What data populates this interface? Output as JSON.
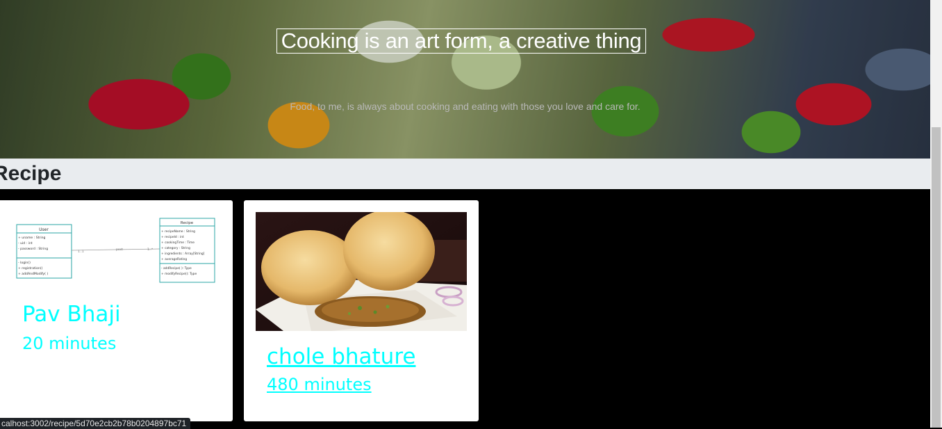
{
  "hero": {
    "title": "Cooking is an art form, a creative thing",
    "subtitle": "Food, to me, is always about cooking and eating with those you love and care for."
  },
  "section": {
    "title": "Recipe"
  },
  "recipes": [
    {
      "name": "Pav Bhaji",
      "time": "20 minutes",
      "image": "uml-class-diagram",
      "diagram": {
        "user_class": {
          "name": "User",
          "attributes": [
            "+ uname : String",
            "- uid : int",
            "- password : String"
          ],
          "methods": [
            "- login()",
            "+ registration()",
            "+ addAndModify( )"
          ]
        },
        "recipe_class": {
          "name": "Recipe",
          "attributes": [
            "+ recipeName : String",
            "+ recipeId : int",
            "+ cookingTime : Time",
            "+ category : String",
            "+ ingredients : Array[String]",
            "+ averageRating"
          ],
          "methods": [
            "- addRecipe( ): Type",
            "+ modifyRecipe(): Type"
          ]
        },
        "association_label": "post",
        "left_multiplicity": "1..1",
        "right_multiplicity": "1..*"
      }
    },
    {
      "name": "chole bhature",
      "time": "480 minutes",
      "image": "chole-bhature-photo"
    }
  ],
  "status_url": "calhost:3002/recipe/5d70e2cb2b78b0204897bc71",
  "colors": {
    "accent": "#00ffff",
    "section_bg": "#e9ecef",
    "page_bg": "#000000"
  }
}
